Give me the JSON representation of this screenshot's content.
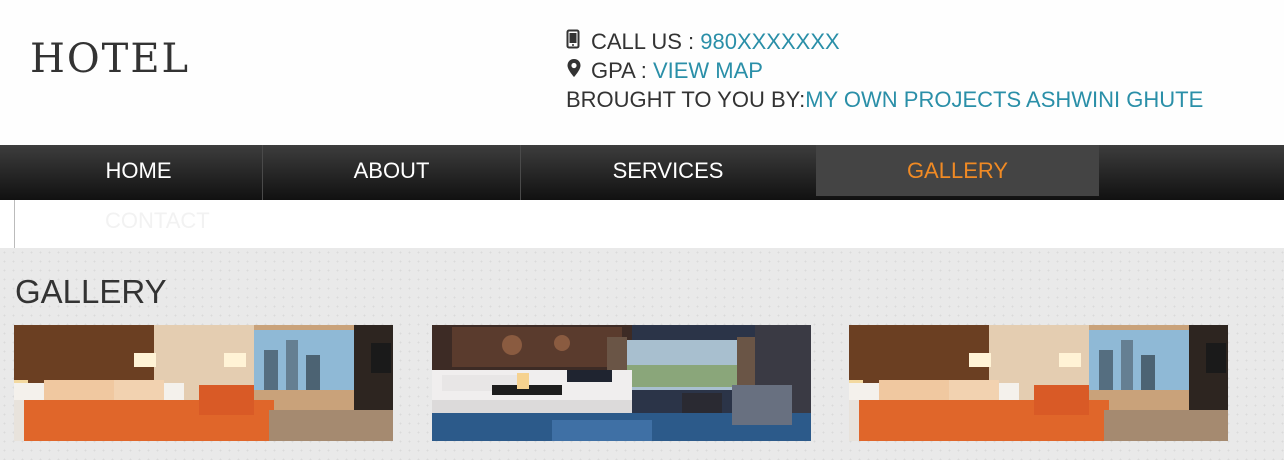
{
  "header": {
    "logo": "HOTEL",
    "call_label": "CALL US :",
    "call_value": "980XXXXXXX",
    "gpa_label": "GPA :",
    "gpa_link": "VIEW MAP",
    "brought_label": "BROUGHT TO YOU BY:",
    "brought_link": "MY OWN PROJECTS ASHWINI GHUTE",
    "icons": [
      "phone-icon",
      "map-marker-icon"
    ]
  },
  "nav": {
    "items": [
      "HOME",
      "ABOUT",
      "SERVICES",
      "GALLERY"
    ],
    "active": "GALLERY",
    "active_color": "#f08a24"
  },
  "subnav": {
    "ghost_text": "CONTACT"
  },
  "gallery": {
    "title": "GALLERY",
    "images": [
      "orange-bed-hotel-room",
      "blue-carpet-hotel-room",
      "orange-bed-hotel-room"
    ]
  },
  "colors": {
    "link": "#2a8fa8",
    "accent": "#f08a24",
    "nav_bg": "#1f1f1f"
  }
}
